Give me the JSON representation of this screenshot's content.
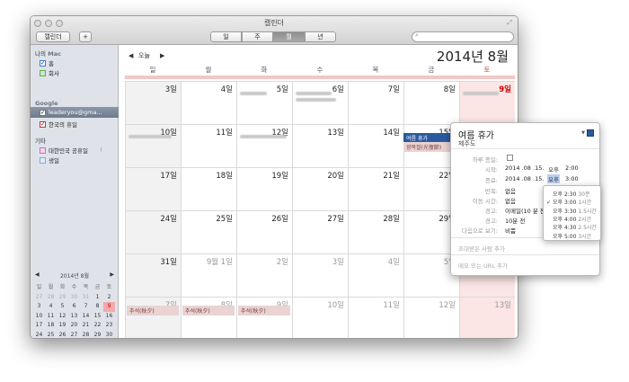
{
  "window": {
    "title": "캘린더"
  },
  "toolbar": {
    "calendars_label": "캘린더",
    "add_label": "+",
    "views": [
      "일",
      "주",
      "월",
      "년"
    ],
    "selected_view": "월"
  },
  "sidebar": {
    "sections": [
      {
        "title": "나의 Mac",
        "items": [
          {
            "label": "홈",
            "checked": true,
            "color": "#3a7bd5"
          },
          {
            "label": "회사",
            "checked": false,
            "color": "#5ab14e"
          }
        ]
      },
      {
        "title": "Google",
        "items": [
          {
            "label": "leaderyou@gma...",
            "checked": true,
            "color": "#7a86a0",
            "selected": true
          },
          {
            "label": "한국의 휴일",
            "checked": true,
            "color": "#c0393b"
          }
        ]
      },
      {
        "title": "기타",
        "items": [
          {
            "label": "대한민국 공휴일",
            "checked": false,
            "color": "#c275b8"
          },
          {
            "label": "생일",
            "checked": false,
            "color": "#8aa7d6"
          }
        ]
      }
    ],
    "mini": {
      "title": "2014년 8월",
      "days": [
        "일",
        "월",
        "화",
        "수",
        "목",
        "금",
        "토"
      ],
      "rows": [
        [
          "27",
          "28",
          "29",
          "30",
          "31",
          "1",
          "2"
        ],
        [
          "3",
          "4",
          "5",
          "6",
          "7",
          "8",
          "9"
        ],
        [
          "10",
          "11",
          "12",
          "13",
          "14",
          "15",
          "16"
        ],
        [
          "17",
          "18",
          "19",
          "20",
          "21",
          "22",
          "23"
        ],
        [
          "24",
          "25",
          "26",
          "27",
          "28",
          "29",
          "30"
        ],
        [
          "31",
          "1",
          "2",
          "3",
          "4",
          "5",
          "6"
        ]
      ],
      "today": "9"
    }
  },
  "calendar": {
    "today_label": "오늘",
    "month_title": "2014년 8월",
    "weekdays": [
      "일",
      "월",
      "화",
      "수",
      "목",
      "금",
      "토"
    ],
    "weeks": [
      [
        "3일",
        "4일",
        "5일",
        "6일",
        "7일",
        "8일",
        "9일"
      ],
      [
        "10일",
        "11일",
        "12일",
        "13일",
        "14일",
        "15일",
        "16일"
      ],
      [
        "17일",
        "18일",
        "19일",
        "20일",
        "21일",
        "22일",
        "23일"
      ],
      [
        "24일",
        "25일",
        "26일",
        "27일",
        "28일",
        "29일",
        "30일"
      ],
      [
        "31일",
        "9월 1일",
        "2일",
        "3일",
        "4일",
        "5일",
        "6일"
      ],
      [
        "7일",
        "8일",
        "9일",
        "10일",
        "11일",
        "12일",
        "13일"
      ]
    ],
    "events": {
      "vacation": "여름 휴가",
      "gwangbok": "광복절(光復節)",
      "chuseok1": "추석(秋夕)",
      "chuseok2": "추석(秋夕)",
      "chuseok3": "추석(秋夕)"
    }
  },
  "popup": {
    "title": "여름 휴가",
    "location": "제주도",
    "allday_label": "하루 종일:",
    "start_label": "시작:",
    "start_date": "2014 .08 .15.",
    "start_ampm": "오후",
    "start_time": "2:00",
    "end_label": "종료:",
    "end_date": "2014 .08 .15.",
    "end_ampm": "오후",
    "end_time": "3:00",
    "repeat_label": "반복:",
    "repeat_value": "없음",
    "travel_label": "이동 시간:",
    "travel_value": "없음",
    "alert_label": "경고:",
    "alert_value": "이메일(10 분 전",
    "alert2_label": "경고:",
    "alert2_value": "10분 전",
    "show_label": "다음으로 보기:",
    "show_value": "비쁨",
    "invite": "초대받은 사람 추가",
    "notes": "메모 또는 URL 추가",
    "accent": "#2c5aa0"
  },
  "end_time_options": [
    {
      "time": "오후 2:30",
      "dur": "30분",
      "checked": false
    },
    {
      "time": "오후 3:00",
      "dur": "1시간",
      "checked": true
    },
    {
      "time": "오후 3:30",
      "dur": "1.5시간",
      "checked": false
    },
    {
      "time": "오후 4:00",
      "dur": "2시간",
      "checked": false
    },
    {
      "time": "오후 4:30",
      "dur": "2.5시간",
      "checked": false
    },
    {
      "time": "오후 5:00",
      "dur": "3시간",
      "checked": false
    }
  ]
}
